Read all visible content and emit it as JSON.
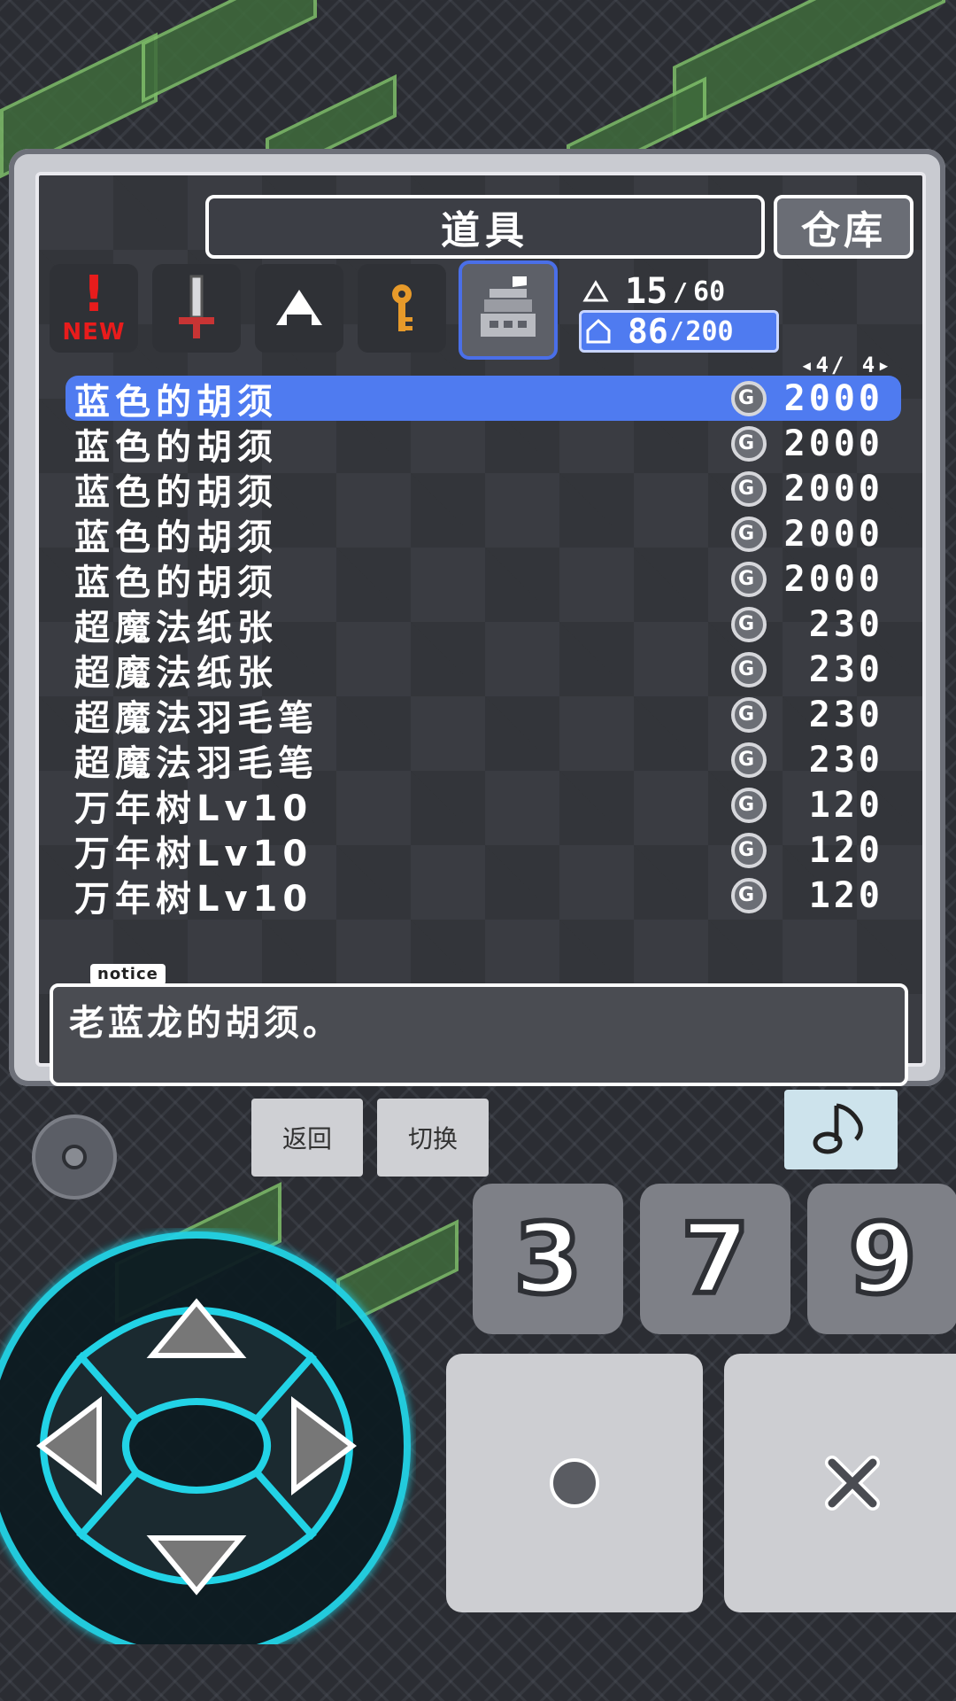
{
  "window": {
    "title": "道具",
    "warehouse_label": "仓库"
  },
  "tabs": [
    {
      "name": "new",
      "label": "NEW",
      "mark": "!"
    },
    {
      "name": "weapon"
    },
    {
      "name": "riceball"
    },
    {
      "name": "key"
    },
    {
      "name": "pot",
      "active": true
    }
  ],
  "stats": {
    "pot_count": "15",
    "pot_max": "60",
    "bag_count": "86",
    "bag_max": "200",
    "pages": "4/ 4"
  },
  "items": [
    {
      "name": "蓝色的胡须",
      "price": "2000",
      "selected": true
    },
    {
      "name": "蓝色的胡须",
      "price": "2000"
    },
    {
      "name": "蓝色的胡须",
      "price": "2000"
    },
    {
      "name": "蓝色的胡须",
      "price": "2000"
    },
    {
      "name": "蓝色的胡须",
      "price": "2000"
    },
    {
      "name": "超魔法纸张",
      "price": "230"
    },
    {
      "name": "超魔法纸张",
      "price": "230"
    },
    {
      "name": "超魔法羽毛笔",
      "price": "230"
    },
    {
      "name": "超魔法羽毛笔",
      "price": "230"
    },
    {
      "name": "万年树Lv10",
      "price": "120"
    },
    {
      "name": "万年树Lv10",
      "price": "120"
    },
    {
      "name": "万年树Lv10",
      "price": "120"
    }
  ],
  "coin_glyph": "G",
  "notice": {
    "label": "notice",
    "text": "老蓝龙的胡须。"
  },
  "controls": {
    "back_label": "返回",
    "switch_label": "切换",
    "num_buttons": [
      "3",
      "7",
      "9"
    ],
    "accent": "#22d3e6"
  }
}
